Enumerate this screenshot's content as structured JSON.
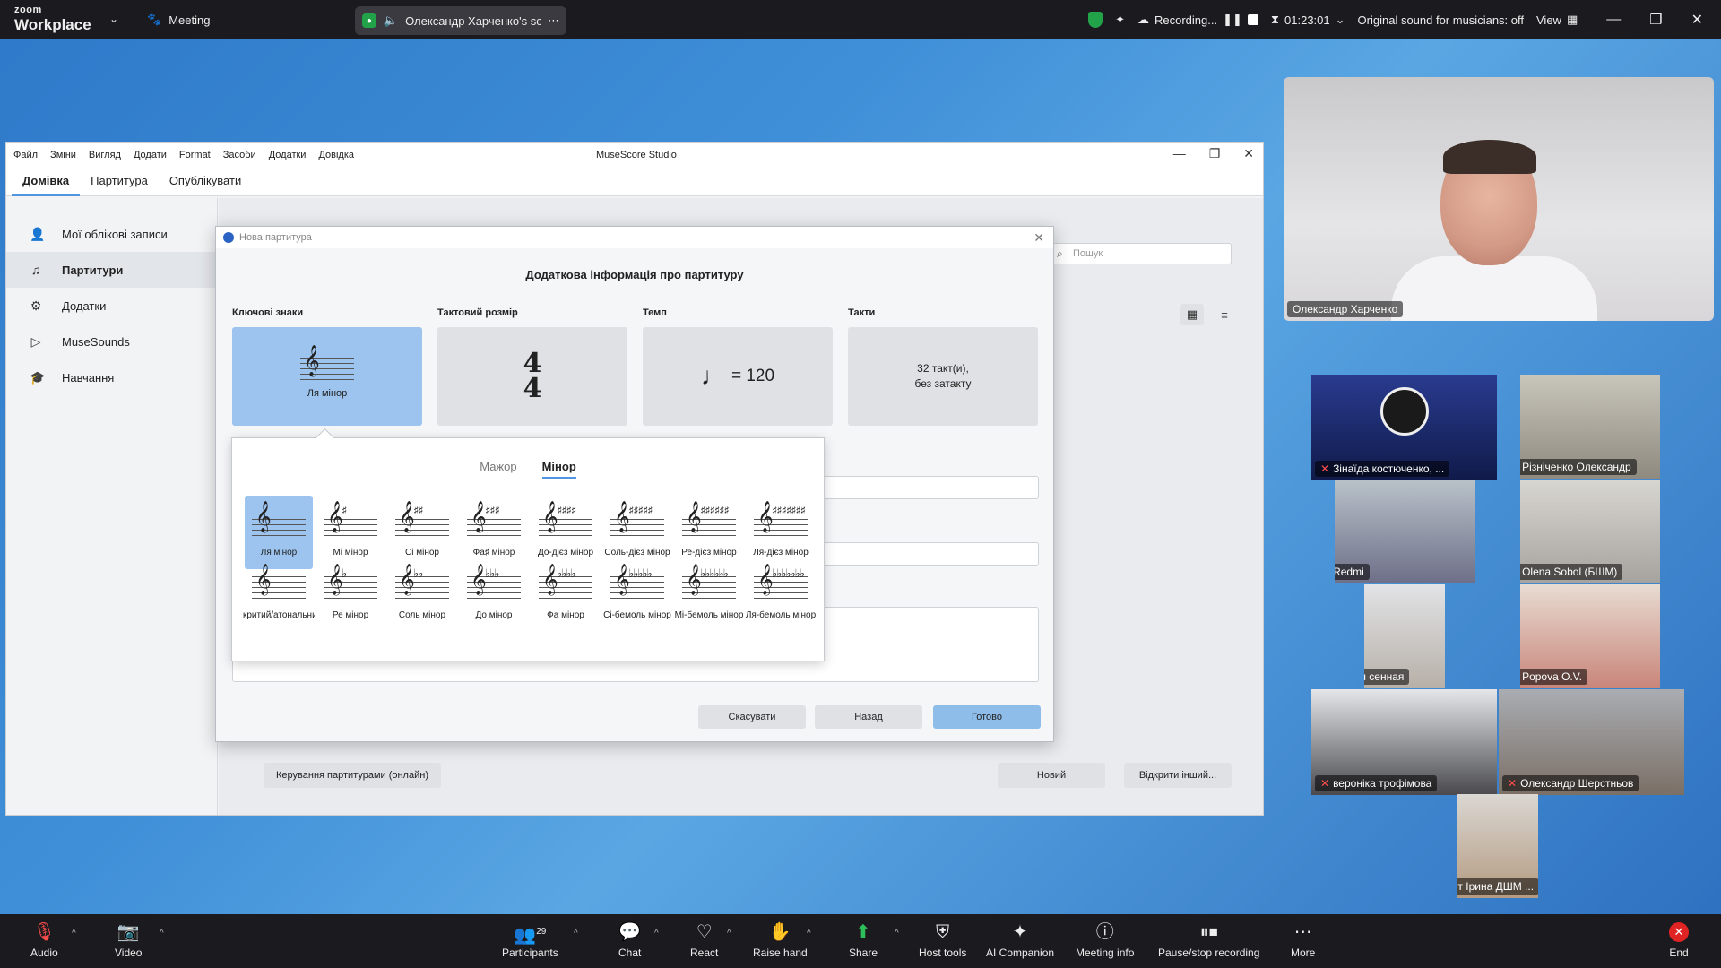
{
  "zoom": {
    "logo_top": "zoom",
    "logo_bottom": "Workplace",
    "meeting_label": "Meeting",
    "share_pill_text": "Олександр Харченко's scre",
    "recording_label": "Recording...",
    "timer": "01:23:01",
    "original_sound": "Original sound for musicians: off",
    "view_label": "View",
    "toolbar": {
      "audio": "Audio",
      "video": "Video",
      "participants": "Participants",
      "participants_count": "29",
      "chat": "Chat",
      "react": "React",
      "raise_hand": "Raise hand",
      "share": "Share",
      "host_tools": "Host tools",
      "ai_companion": "AI Companion",
      "meeting_info": "Meeting info",
      "pause_stop": "Pause/stop recording",
      "more": "More",
      "end": "End"
    }
  },
  "musescore": {
    "window_title": "MuseScore Studio",
    "menu": [
      "Файл",
      "Зміни",
      "Вигляд",
      "Додати",
      "Format",
      "Засоби",
      "Додатки",
      "Довідка"
    ],
    "tabs": [
      "Домівка",
      "Партитура",
      "Опублікувати"
    ],
    "sidebar": [
      "Мої облікові записи",
      "Партитури",
      "Додатки",
      "MuseSounds",
      "Навчання"
    ],
    "search_placeholder": "Пошук",
    "bottom_buttons": {
      "manage": "Керування партитурами (онлайн)",
      "new": "Новий",
      "open_other": "Відкрити інший..."
    }
  },
  "dialog": {
    "title": "Нова партитура",
    "heading": "Додаткова інформація про партитуру",
    "sections": {
      "key": "Ключові знаки",
      "time": "Тактовий розмір",
      "tempo": "Темп",
      "bars": "Такти"
    },
    "key_value": "Ля мінор",
    "time_top": "4",
    "time_bottom": "4",
    "tempo_value": "= 120",
    "bars_line1": "32 такт(и),",
    "bars_line2": "без затакту",
    "buttons": {
      "cancel": "Скасувати",
      "back": "Назад",
      "done": "Готово"
    }
  },
  "key_popup": {
    "tab_major": "Мажор",
    "tab_minor": "Мінор",
    "row1": [
      {
        "label": "Ля мінор",
        "acc": ""
      },
      {
        "label": "Мі мінор",
        "acc": "♯"
      },
      {
        "label": "Сі мінор",
        "acc": "♯♯"
      },
      {
        "label": "Фа♯ мінор",
        "acc": "♯♯♯"
      },
      {
        "label": "До-дієз мінор",
        "acc": "♯♯♯♯"
      },
      {
        "label": "Соль-дієз мінор",
        "acc": "♯♯♯♯♯"
      },
      {
        "label": "Ре-дієз мінор",
        "acc": "♯♯♯♯♯♯"
      },
      {
        "label": "Ля-дієз мінор",
        "acc": "♯♯♯♯♯♯♯"
      }
    ],
    "row2": [
      {
        "label": "критий/атональний",
        "acc": ""
      },
      {
        "label": "Ре мінор",
        "acc": "♭"
      },
      {
        "label": "Соль мінор",
        "acc": "♭♭"
      },
      {
        "label": "До мінор",
        "acc": "♭♭♭"
      },
      {
        "label": "Фа мінор",
        "acc": "♭♭♭♭"
      },
      {
        "label": "Сі-бемоль мінор",
        "acc": "♭♭♭♭♭"
      },
      {
        "label": "Мі-бемоль мінор",
        "acc": "♭♭♭♭♭♭"
      },
      {
        "label": "Ля-бемоль мінор",
        "acc": "♭♭♭♭♭♭♭"
      }
    ]
  },
  "participants": {
    "main": "Олександр Харченко",
    "tiles": [
      "Зінаїда костюченко, ...",
      "Різніченко Олександр",
      "Redmi",
      "Olena Sobol (БШМ)",
      "лидия сенная",
      "Popova O.V.",
      "вероніка трофімова",
      "Олександр Шерстньов",
      "Демент Ірина ДШМ ..."
    ]
  },
  "colors": {
    "zoom_bar": "#1b1b1f",
    "selected": "#9cc4ee",
    "accent": "#4f95e0",
    "record": "#e02424",
    "secure": "#22a34a"
  }
}
